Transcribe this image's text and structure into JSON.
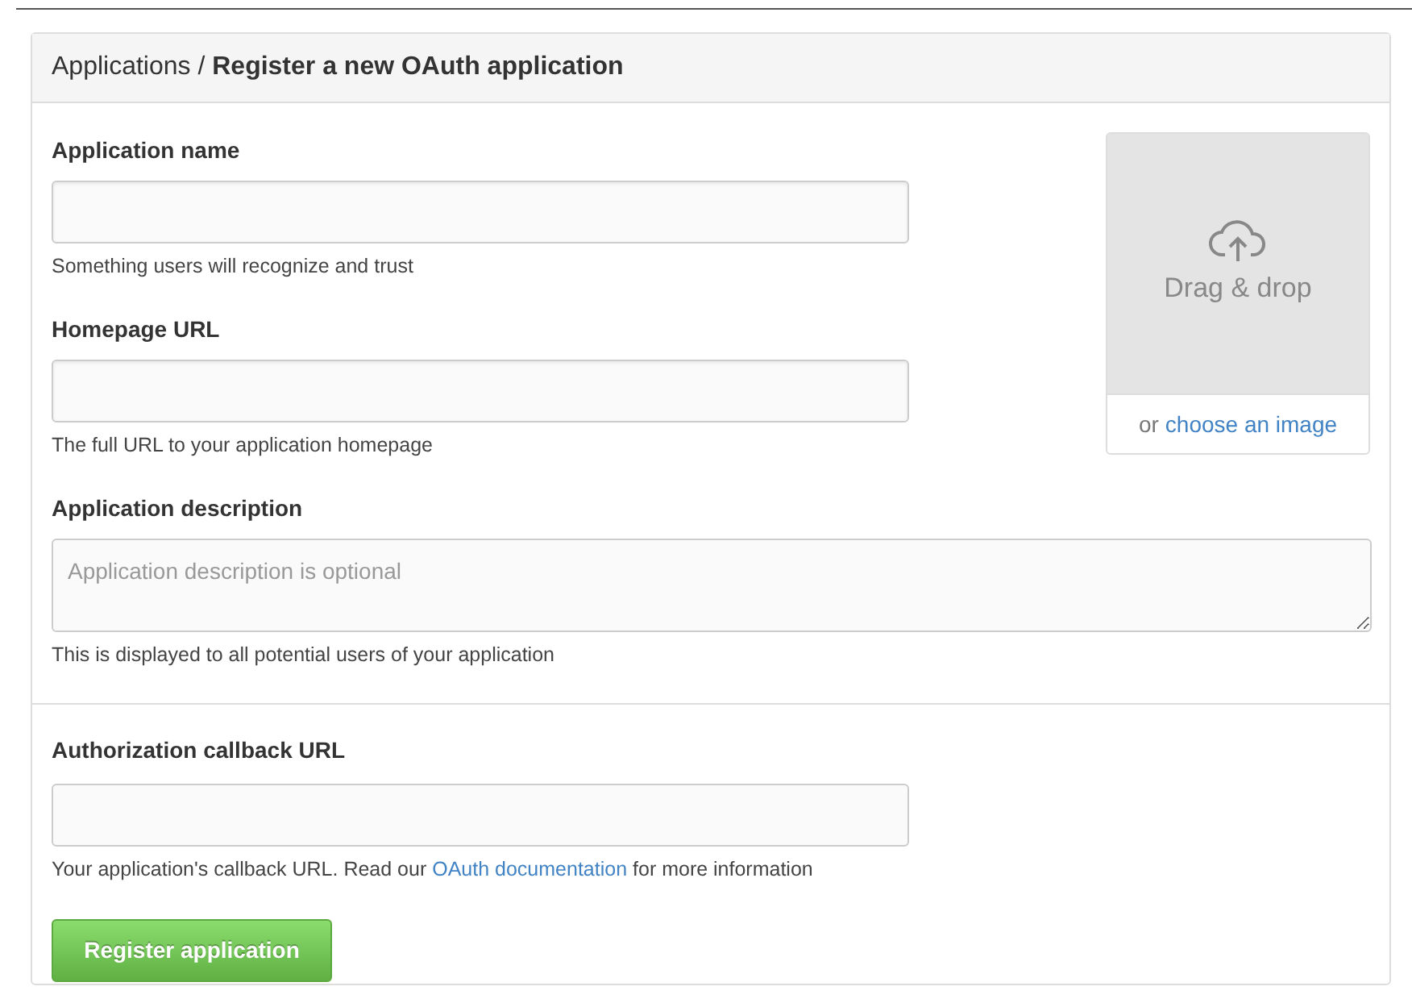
{
  "header": {
    "title": "Applications / **Register a new OAuth application**"
  },
  "fields": [
    {
      "kind": "input",
      "label": "Application name",
      "help": "Something users will recognize and trust"
    },
    {
      "kind": "input",
      "label": "Homepage URL",
      "help": "The full URL to your application homepage"
    }
  ],
  "description": {
    "label": "Application description",
    "placeholder": "Application description is optional",
    "help": "This is displayed to all potential users of your application"
  },
  "image_upload": {
    "drop_text": "Drag & drop",
    "prefix": "or",
    "link": "choose an image"
  },
  "callback": {
    "label": "Authorization callback URL",
    "help_before": "Your application's callback URL. Read our",
    "help_link": "OAuth documentation",
    "help_after": "for more information"
  },
  "submit": {
    "label": "Register application"
  }
}
